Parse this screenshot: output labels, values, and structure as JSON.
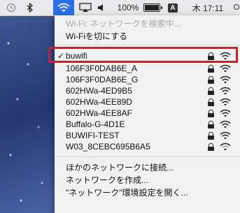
{
  "menubar": {
    "battery_percent": "100%",
    "input_source": "A",
    "clock": "木 17:11"
  },
  "wifi_menu": {
    "searching_text": "Wi-Fi: ネットワークを検索中...",
    "turn_off_label": "Wi-Fiを切にする",
    "connected_network": "buwifi",
    "networks": [
      {
        "name": "106F3F0DAB6E_A"
      },
      {
        "name": "106F3F0DAB6E_G"
      },
      {
        "name": "602HWa-4ED9B5"
      },
      {
        "name": "602HWa-4EE89D"
      },
      {
        "name": "602HWa-4EE8AF"
      },
      {
        "name": "Buffalo-G-4D1E"
      },
      {
        "name": "BUWIFI-TEST"
      },
      {
        "name": "W03_8CEBC695B6A5"
      }
    ],
    "join_other": "ほかのネットワークに接続...",
    "create_network": "ネットワークを作成...",
    "open_prefs": "\"ネットワーク\"環境設定を開く..."
  },
  "colors": {
    "highlight_border": "#e4161a",
    "wifi_active_bg": "#2a6fe6"
  }
}
